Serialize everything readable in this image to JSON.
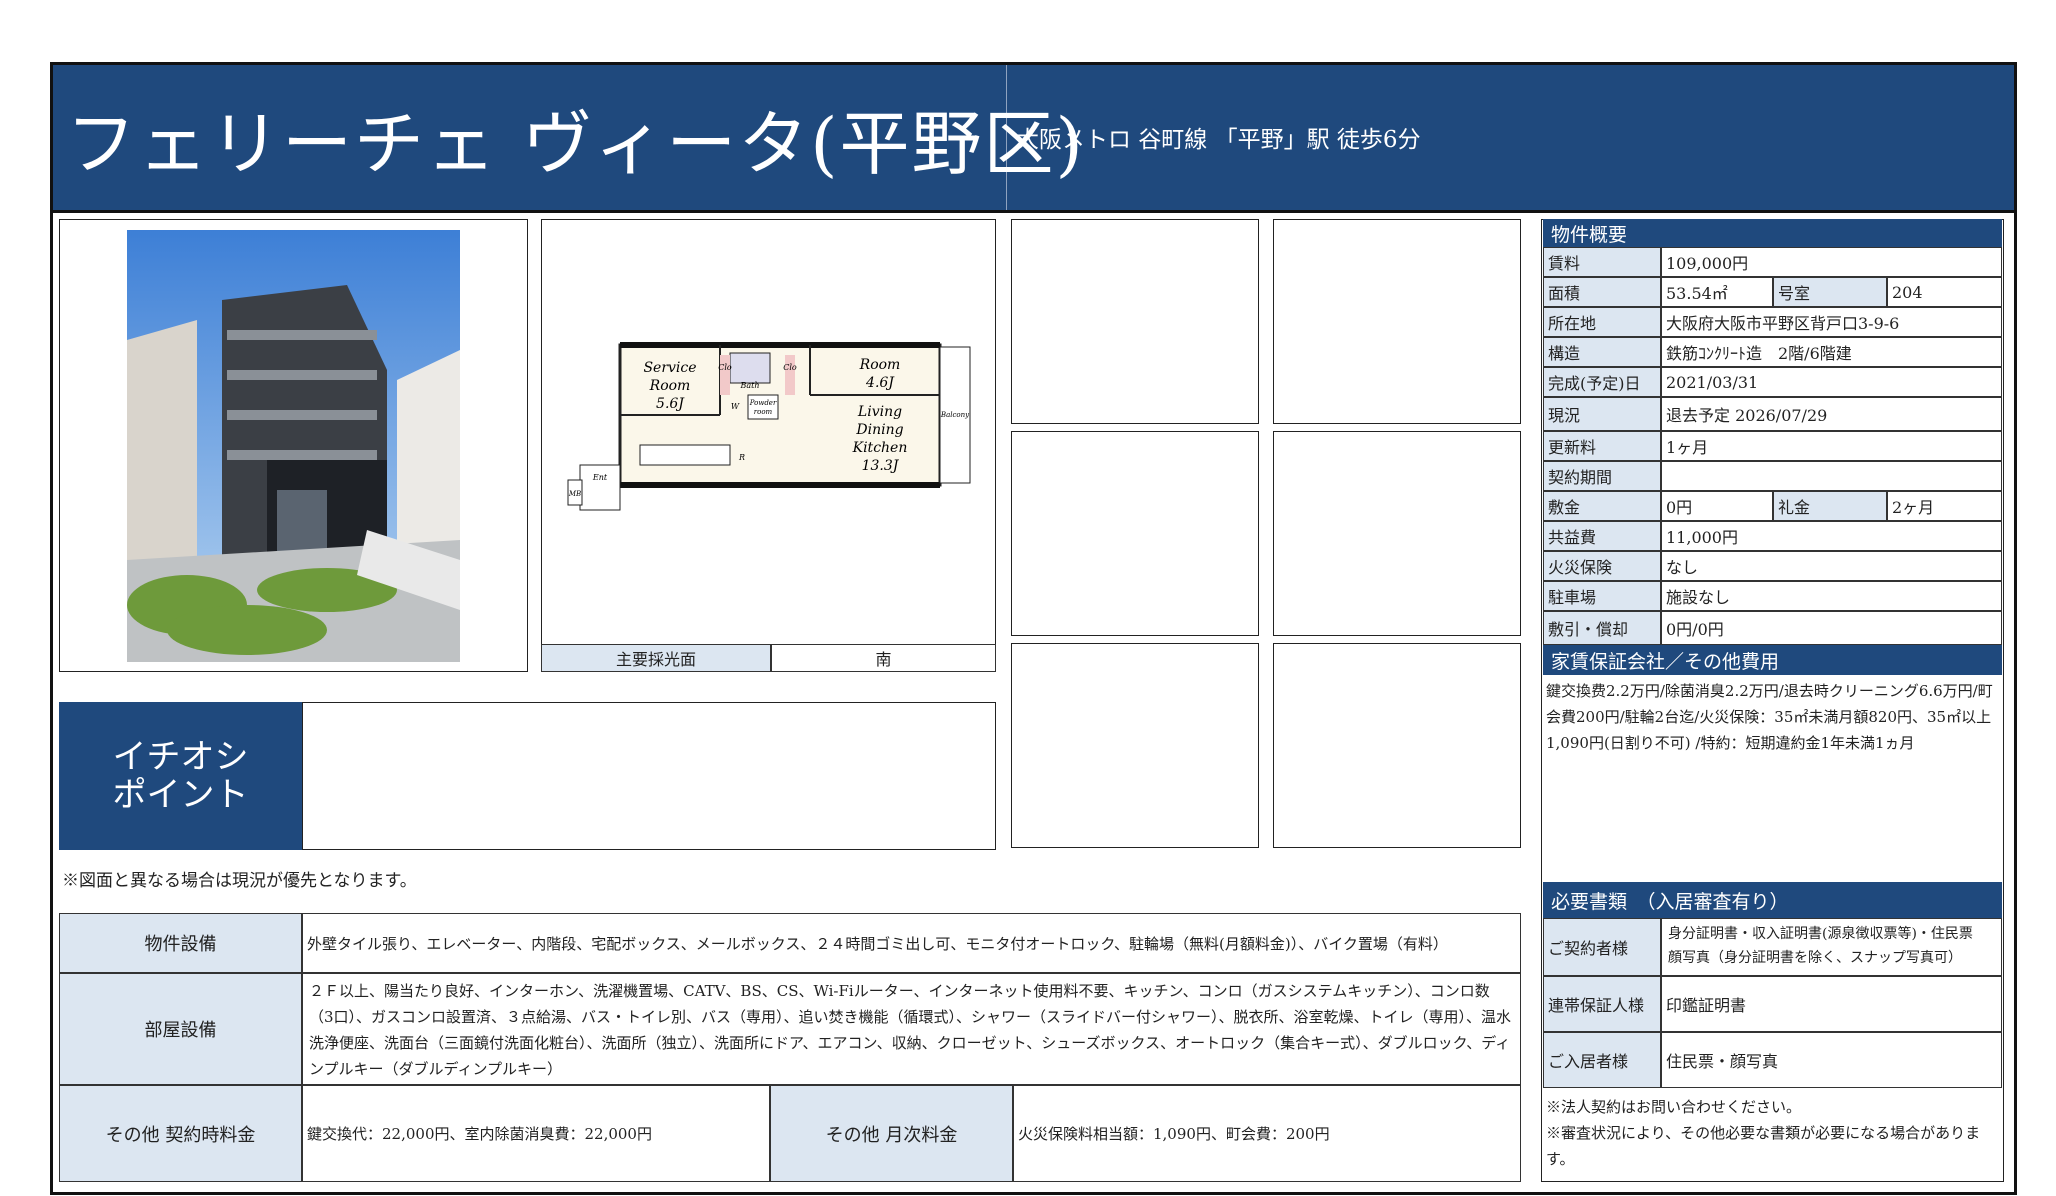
{
  "header": {
    "title": "フェリーチェ ヴィータ(平野区)",
    "access": "大阪メトロ 谷町線 「平野」駅 徒歩6分"
  },
  "floorplan": {
    "rooms": {
      "service_room": [
        "Service",
        "Room",
        "5.6J"
      ],
      "room": [
        "Room",
        "4.6J"
      ],
      "ldk": [
        "Living",
        "Dining",
        "Kitchen",
        "13.3J"
      ],
      "bath": "Bath",
      "balcony": "Balcony",
      "powder": [
        "Powder",
        "room"
      ],
      "clo_1": "Clo",
      "clo_2": "Clo",
      "ent": "Ent",
      "mb": "MB",
      "w": "W",
      "r": "R"
    },
    "light_label": "主要採光面",
    "light_value": "南"
  },
  "point": {
    "label_line1": "イチオシ",
    "label_line2": "ポイント",
    "content": ""
  },
  "note": "※図面と異なる場合は現況が優先となります。",
  "facilities": {
    "building_label": "物件設備",
    "building_value": "外壁タイル張り、エレベーター、内階段、宅配ボックス、メールボックス、２４時間ゴミ出し可、モニタ付オートロック、駐輪場（無料(月額料金)）、バイク置場（有料）",
    "room_label": "部屋設備",
    "room_value": "２Ｆ以上、陽当たり良好、インターホン、洗濯機置場、CATV、BS、CS、Wi-Fiルーター、インターネット使用料不要、キッチン、コンロ（ガスシステムキッチン）、コンロ数（3口）、ガスコンロ設置済、３点給湯、バス・トイレ別、バス（専用）、追い焚き機能（循環式）、シャワー（スライドバー付シャワー）、脱衣所、浴室乾燥、トイレ（専用）、温水洗浄便座、洗面台（三面鏡付洗面化粧台）、洗面所（独立）、洗面所にドア、エアコン、収納、クローゼット、シューズボックス、オートロック（集合キー式）、ダブルロック、ディンプルキー（ダブルディンプルキー）",
    "contract_label": "その他 契約時料金",
    "contract_value": "鍵交換代：22,000円、室内除菌消臭費：22,000円",
    "monthly_label": "その他 月次料金",
    "monthly_value": "火災保険料相当額：1,090円、町会費：200円"
  },
  "overview": {
    "section_title": "物件概要",
    "rent_label": "賃料",
    "rent": "109,000円",
    "area_label": "面積",
    "area": "53.54㎡",
    "roomno_label": "号室",
    "roomno": "204",
    "address_label": "所在地",
    "address": "大阪府大阪市平野区背戸口3-9-6",
    "structure_label": "構造",
    "structure": "鉄筋ｺﾝｸﾘｰﾄ造　2階/6階建",
    "built_label": "完成(予定)日",
    "built": "2021/03/31",
    "status_label": "現況",
    "status": "退去予定 2026/07/29",
    "renewal_label": "更新料",
    "renewal": "1ヶ月",
    "period_label": "契約期間",
    "period": "",
    "deposit_label": "敷金",
    "deposit": "0円",
    "keymoney_label": "礼金",
    "keymoney": "2ヶ月",
    "common_label": "共益費",
    "common": "11,000円",
    "fire_label": "火災保険",
    "fire": "なし",
    "parking_label": "駐車場",
    "parking": "施設なし",
    "shiki_label": "敷引・償却",
    "shiki": "0円/0円"
  },
  "guarantee": {
    "section_title": "家賃保証会社／その他費用",
    "text": "鍵交換费2.2万円/除菌消臭2.2万円/退去時クリーニング6.6万円/町会費200円/駐輪2台迄/火災保険：35㎡未満月額820円、35㎡以上1,090円(日割り不可) /特約：短期違約金1年未満1ヵ月"
  },
  "documents": {
    "section_title": "必要書類　（入居審査有り）",
    "contractor_label": "ご契約者様",
    "contractor": "身分証明書・収入証明書(源泉徴収票等)・住民票　顔写真（身分証明書を除く、スナップ写真可）",
    "guarantor_label": "連帯保証人様",
    "guarantor": "印鑑証明書",
    "resident_label": "ご入居者様",
    "resident": "住民票・顔写真",
    "note1": "※法人契約はお問い合わせください。",
    "note2": "※審査状況により、その他必要な書類が必要になる場合があります。"
  },
  "colors": {
    "navy": "#1f497d",
    "label_bg": "#dce6f1"
  }
}
